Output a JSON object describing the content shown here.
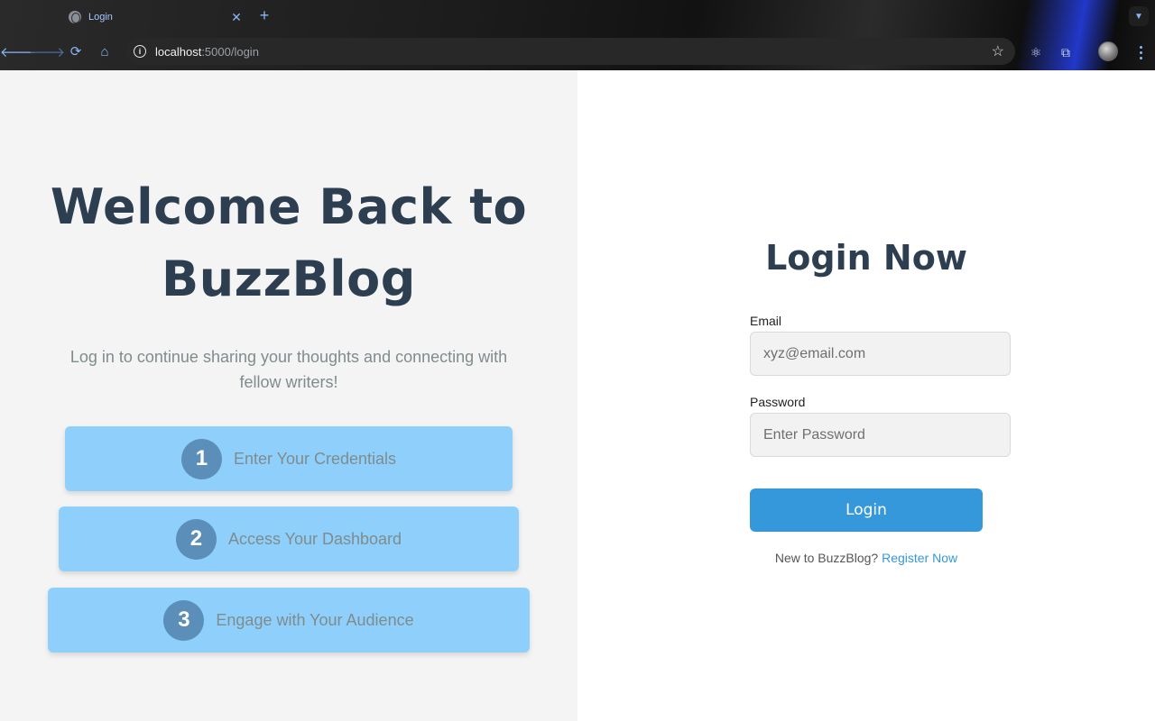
{
  "browser": {
    "tab_title": "Login",
    "url_host": "localhost",
    "url_path": ":5000/login"
  },
  "hero": {
    "title_line1": "Welcome Back to",
    "title_line2": "BuzzBlog",
    "subtitle": "Log in to continue sharing your thoughts and connecting with fellow writers!",
    "steps": [
      {
        "number": "1",
        "label": "Enter Your Credentials"
      },
      {
        "number": "2",
        "label": "Access Your Dashboard"
      },
      {
        "number": "3",
        "label": "Engage with Your Audience"
      }
    ]
  },
  "login": {
    "title": "Login Now",
    "email_label": "Email",
    "email_placeholder": "xyz@email.com",
    "password_label": "Password",
    "password_placeholder": "Enter Password",
    "button_label": "Login",
    "register_prompt": "New to BuzzBlog?",
    "register_link": "Register Now"
  },
  "colors": {
    "accent": "#3498db",
    "heading": "#2c3e50",
    "step_bg": "#8ed0fb",
    "step_circle": "#5b8fb9"
  }
}
